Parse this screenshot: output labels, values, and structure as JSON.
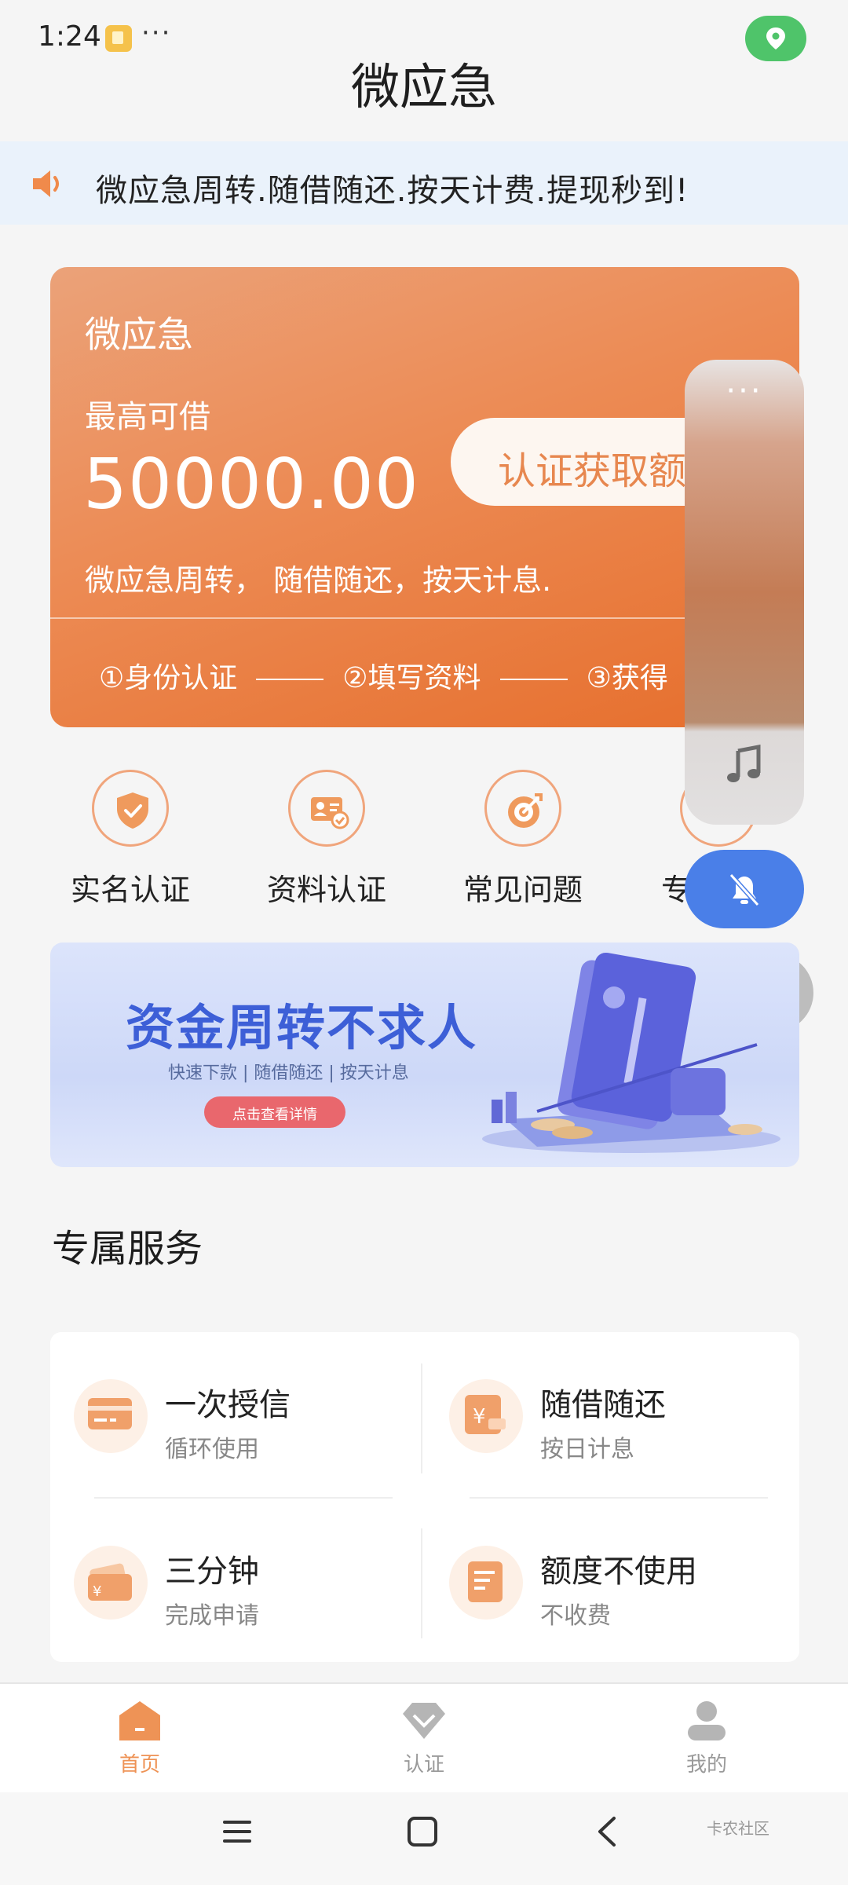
{
  "status_bar": {
    "time": "1:24",
    "more": "···"
  },
  "header": {
    "title": "微应急"
  },
  "notice": {
    "text": "微应急周转.随借随还.按天计费.提现秒到!"
  },
  "hero": {
    "name": "微应急",
    "max_label": "最高可借",
    "amount": "50000.00",
    "cta_label": "认证获取额",
    "description": "微应急周转， 随借随还，按天计息.",
    "steps": [
      "①身份认证",
      "②填写资料",
      "③获得"
    ]
  },
  "overlay": {
    "dots": "···"
  },
  "quick_actions": [
    {
      "label": "实名认证",
      "icon": "shield-check-icon"
    },
    {
      "label": "资料认证",
      "icon": "id-card-icon"
    },
    {
      "label": "常见问题",
      "icon": "target-icon"
    },
    {
      "label": "专",
      "icon": "partial-icon"
    }
  ],
  "banner": {
    "title": "资金周转不求人",
    "subtitle": "快速下款 | 随借随还 | 按天计息",
    "button": "点击查看详情"
  },
  "services": {
    "title": "专属服务",
    "items": [
      {
        "title": "一次授信",
        "subtitle": "循环使用",
        "icon": "card-icon"
      },
      {
        "title": "随借随还",
        "subtitle": "按日计息",
        "icon": "yen-bill-icon"
      },
      {
        "title": "三分钟",
        "subtitle": "完成申请",
        "icon": "wallet-icon"
      },
      {
        "title": "额度不使用",
        "subtitle": "不收费",
        "icon": "document-icon"
      }
    ]
  },
  "tabs": [
    {
      "label": "首页",
      "active": true,
      "icon": "home-icon"
    },
    {
      "label": "认证",
      "active": false,
      "icon": "diamond-icon"
    },
    {
      "label": "我的",
      "active": false,
      "icon": "user-icon"
    }
  ],
  "watermark": {
    "text": "卡农社区"
  },
  "colors": {
    "accent": "#ec8a53",
    "active_tab": "#ee9356",
    "inactive_tab": "#9a9a9a",
    "banner_title": "#3d5fd7"
  }
}
